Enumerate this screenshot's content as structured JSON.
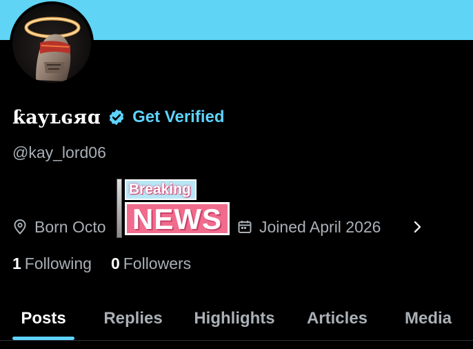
{
  "profile": {
    "display_name": "ƙayʟɢяɑ",
    "get_verified_label": "Get Verified",
    "handle": "@kay_lord06"
  },
  "meta": {
    "location_label": "Born Octo",
    "joined_label": "Joined April 2026"
  },
  "overlay": {
    "breaking_label": "Breaking",
    "news_label": "NEWS"
  },
  "stats": {
    "following_count": "1",
    "following_label": "Following",
    "followers_count": "0",
    "followers_label": "Followers"
  },
  "tabs": [
    {
      "label": "Posts",
      "active": true
    },
    {
      "label": "Replies",
      "active": false
    },
    {
      "label": "Highlights",
      "active": false
    },
    {
      "label": "Articles",
      "active": false
    },
    {
      "label": "Media",
      "active": false
    }
  ],
  "colors": {
    "banner": "#5fd4f5",
    "accent": "#5ed3ff",
    "background": "#000000",
    "muted_text": "#a9b0b6",
    "news_pink": "#f16b8c"
  },
  "icons": {
    "verified": "verified-badge-icon",
    "location": "location-pin-icon",
    "calendar": "calendar-icon",
    "chevron": "chevron-right-icon"
  }
}
